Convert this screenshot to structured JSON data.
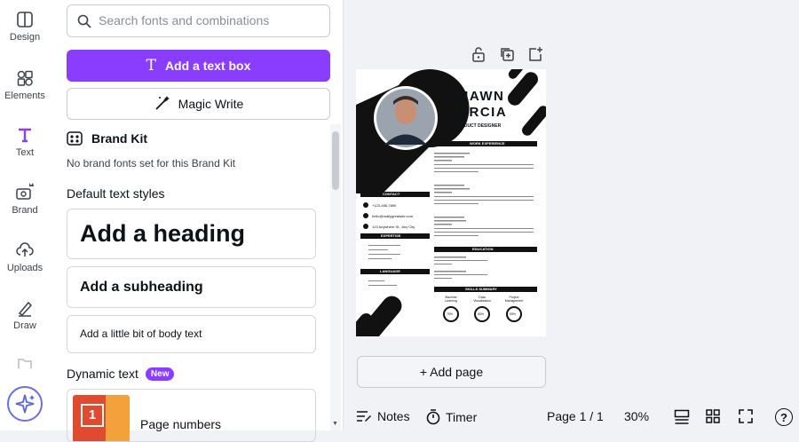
{
  "rail": {
    "items": [
      {
        "label": "Design",
        "icon": "design-icon"
      },
      {
        "label": "Elements",
        "icon": "elements-icon"
      },
      {
        "label": "Text",
        "icon": "text-icon"
      },
      {
        "label": "Brand",
        "icon": "brand-icon"
      },
      {
        "label": "Uploads",
        "icon": "uploads-icon"
      },
      {
        "label": "Draw",
        "icon": "draw-icon"
      }
    ]
  },
  "panel": {
    "search_placeholder": "Search fonts and combinations",
    "add_text_box": "Add a text box",
    "magic_write": "Magic Write",
    "brand_kit": "Brand Kit",
    "brand_note": "No brand fonts set for this Brand Kit",
    "default_styles_title": "Default text styles",
    "heading": "Add a heading",
    "subheading": "Add a subheading",
    "body": "Add a little bit of body text",
    "dynamic_title": "Dynamic text",
    "new_badge": "New",
    "page_numbers": "Page numbers",
    "page_numbers_thumb": "1"
  },
  "resume": {
    "first_name": "SHAWN",
    "last_name": "GARCIA",
    "role": "PRODUCT DESIGNER",
    "work_title": "WORK EXPERIENCE",
    "contact_title": "CONTACT",
    "phone": "+123-456-7890",
    "email": "hello@reallygreatsite.com",
    "address": "123 Anywhere St., Any City",
    "expertise_title": "EXPERTISE",
    "expertise": [
      "Management Skills",
      "Creativity",
      "Digital Marketing",
      "Negotiation"
    ],
    "language_title": "LANGUAGE",
    "languages": [
      "English",
      "Germany (basic)"
    ],
    "education_title": "EDUCATION",
    "skills_title": "SKILLS SUMMARY",
    "skills": [
      "Machine Learning",
      "Data Visualization",
      "Project Management"
    ],
    "skill_values": [
      "75%",
      "80%",
      "95%"
    ]
  },
  "canvas": {
    "add_page": "+ Add page"
  },
  "bottombar": {
    "notes": "Notes",
    "timer": "Timer",
    "page": "Page 1 / 1",
    "zoom": "30%",
    "help": "?"
  },
  "colors": {
    "accent": "#8b3dff",
    "canvas_bg": "#f1f2f6"
  }
}
